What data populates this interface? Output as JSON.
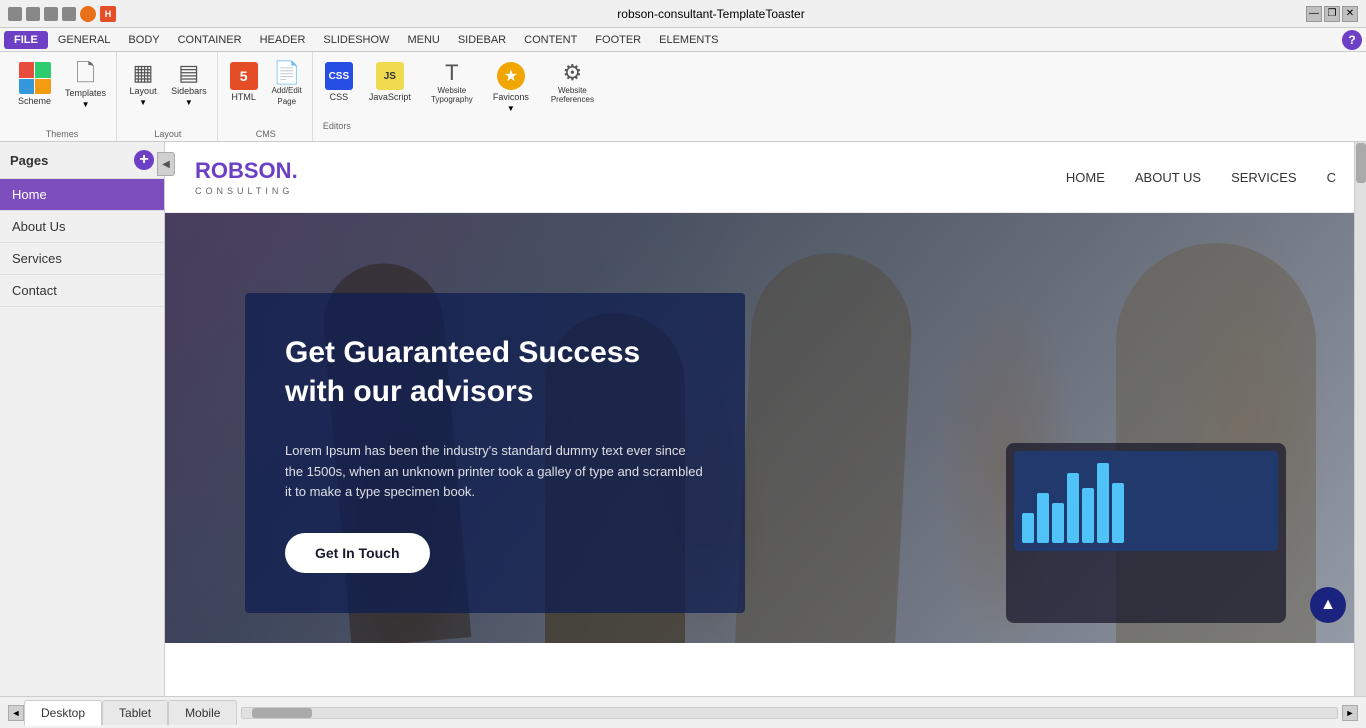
{
  "window": {
    "title": "robson-consultant-TemplateToaster",
    "controls": {
      "minimize": "—",
      "restore": "❐",
      "close": "✕"
    }
  },
  "menubar": {
    "items": [
      "FILE",
      "GENERAL",
      "BODY",
      "CONTAINER",
      "HEADER",
      "SLIDESHOW",
      "MENU",
      "SIDEBAR",
      "CONTENT",
      "FOOTER",
      "ELEMENTS"
    ]
  },
  "ribbon": {
    "groups": [
      {
        "label": "Themes",
        "items": [
          {
            "id": "scheme",
            "label": "Scheme",
            "type": "scheme"
          },
          {
            "id": "templates",
            "label": "Templates",
            "type": "templates"
          }
        ]
      },
      {
        "label": "Layout",
        "items": [
          {
            "id": "layout",
            "label": "Layout",
            "type": "layout"
          },
          {
            "id": "sidebars",
            "label": "Sidebars",
            "type": "sidebars"
          }
        ]
      },
      {
        "label": "CMS",
        "items": [
          {
            "id": "html",
            "label": "HTML",
            "type": "html5"
          },
          {
            "id": "add-edit",
            "label": "Add/Edit Page",
            "type": "add-edit"
          }
        ]
      },
      {
        "label": "Editors",
        "items": [
          {
            "id": "css",
            "label": "CSS",
            "type": "css"
          },
          {
            "id": "javascript",
            "label": "JavaScript",
            "type": "js"
          },
          {
            "id": "typography",
            "label": "Website Typography",
            "type": "typo"
          },
          {
            "id": "favicons",
            "label": "Favicons",
            "type": "fav"
          },
          {
            "id": "preferences",
            "label": "Website Preferences",
            "type": "pref"
          }
        ]
      }
    ],
    "help_icon": "?"
  },
  "sidebar": {
    "title": "Pages",
    "add_tooltip": "+",
    "pages": [
      {
        "id": "home",
        "label": "Home",
        "active": true
      },
      {
        "id": "about",
        "label": "About Us",
        "active": false
      },
      {
        "id": "services",
        "label": "Services",
        "active": false
      },
      {
        "id": "contact",
        "label": "Contact",
        "active": false
      }
    ]
  },
  "site": {
    "logo": {
      "name": "ROBSON",
      "dot": ".",
      "subtitle": "CONSULTING"
    },
    "nav": {
      "links": [
        "HOME",
        "ABOUT US",
        "SERVICES",
        "C"
      ]
    },
    "hero": {
      "title": "Get Guaranteed Success with our advisors",
      "description": "Lorem Ipsum has been the industry's standard dummy text ever since the 1500s, when an unknown printer took a galley of type and scrambled it to make a type specimen book.",
      "button": "Get In Touch"
    }
  },
  "bottom_bar": {
    "tabs": [
      {
        "id": "desktop",
        "label": "Desktop",
        "active": true
      },
      {
        "id": "tablet",
        "label": "Tablet",
        "active": false
      },
      {
        "id": "mobile",
        "label": "Mobile",
        "active": false
      }
    ]
  },
  "icons": {
    "collapse": "◀",
    "scroll_up": "▲",
    "scroll_left": "◄",
    "scroll_right": "►"
  }
}
